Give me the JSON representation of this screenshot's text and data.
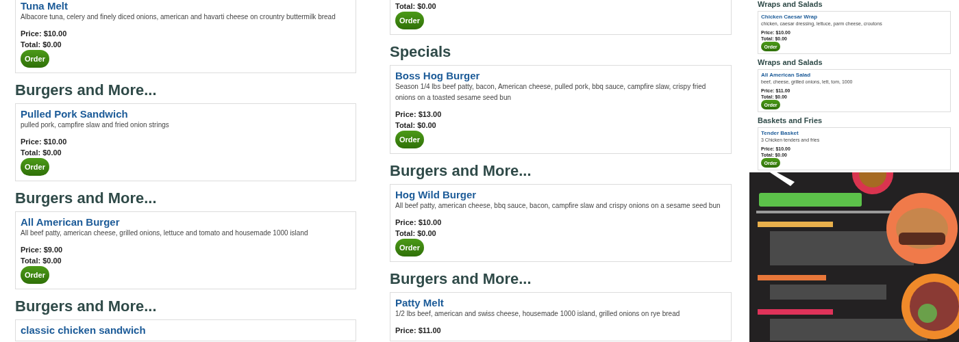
{
  "columns": [
    {
      "kind": "full",
      "blocks": [
        {
          "kind": "card",
          "title": "Tuna Melt",
          "description": "Albacore tuna, celery and finely diced onions, american and havarti cheese on crountry buttermilk bread",
          "price": "Price: $10.00",
          "total": "Total: $0.00",
          "button": "Order"
        },
        {
          "kind": "heading",
          "text": "Burgers and More..."
        },
        {
          "kind": "card",
          "title": "Pulled Pork Sandwich",
          "description": "pulled pork, campfire slaw and fried onion strings",
          "price": "Price: $10.00",
          "total": "Total: $0.00",
          "button": "Order"
        },
        {
          "kind": "heading",
          "text": "Burgers and More..."
        },
        {
          "kind": "card",
          "title": "All American Burger",
          "description": "All beef patty, american cheese, grilled onions, lettuce and tomato and housemade 1000 island",
          "price": "Price: $9.00",
          "total": "Total: $0.00",
          "button": "Order"
        },
        {
          "kind": "heading",
          "text": "Burgers and More..."
        },
        {
          "kind": "card",
          "title": "classic chicken sandwich"
        }
      ]
    },
    {
      "kind": "full",
      "blocks": [
        {
          "kind": "card",
          "total": "Total: $0.00",
          "button": "Order"
        },
        {
          "kind": "heading",
          "text": "Specials"
        },
        {
          "kind": "card",
          "title": "Boss Hog Burger",
          "description": "Season 1/4 lbs beef patty, bacon, American cheese, pulled pork, bbq sauce, campfire slaw, crispy fried onions on a toasted sesame seed bun",
          "price": "Price: $13.00",
          "total": "Total: $0.00",
          "button": "Order"
        },
        {
          "kind": "heading",
          "text": "Burgers and More..."
        },
        {
          "kind": "card",
          "title": "Hog Wild Burger",
          "description": "All beef patty, american cheese, bbq sauce, bacon, campfire slaw and crispy onions on a sesame seed bun",
          "price": "Price: $10.00",
          "total": "Total: $0.00",
          "button": "Order"
        },
        {
          "kind": "heading",
          "text": "Burgers and More..."
        },
        {
          "kind": "card",
          "title": "Patty Melt",
          "description": "1/2 lbs beef, american and swiss cheese, housemade 1000 island, grilled onions on rye bread",
          "price": "Price: $11.00"
        }
      ]
    },
    {
      "kind": "mini",
      "blocks": [
        {
          "kind": "heading",
          "text": "Wraps and Salads"
        },
        {
          "kind": "card",
          "title": "Chicken Caesar Wrap",
          "description": "chicken, caesar dressing, lettuce, parm cheese, croutons",
          "price": "Price: $10.00",
          "total": "Total: $0.00",
          "button": "Order"
        },
        {
          "kind": "heading",
          "text": "Wraps and Salads"
        },
        {
          "kind": "card",
          "title": "All American Salad",
          "description": "beef, cheese, grilled onions, lett, tom, 1000",
          "price": "Price: $11.00",
          "total": "Total: $0.00",
          "button": "Order"
        },
        {
          "kind": "heading",
          "text": "Baskets and Fries"
        },
        {
          "kind": "card",
          "title": "Tender Basket",
          "description": "3 Chicken tenders and fries",
          "price": "Price: $10.00",
          "total": "Total: $0.00",
          "button": "Order"
        }
      ]
    }
  ]
}
